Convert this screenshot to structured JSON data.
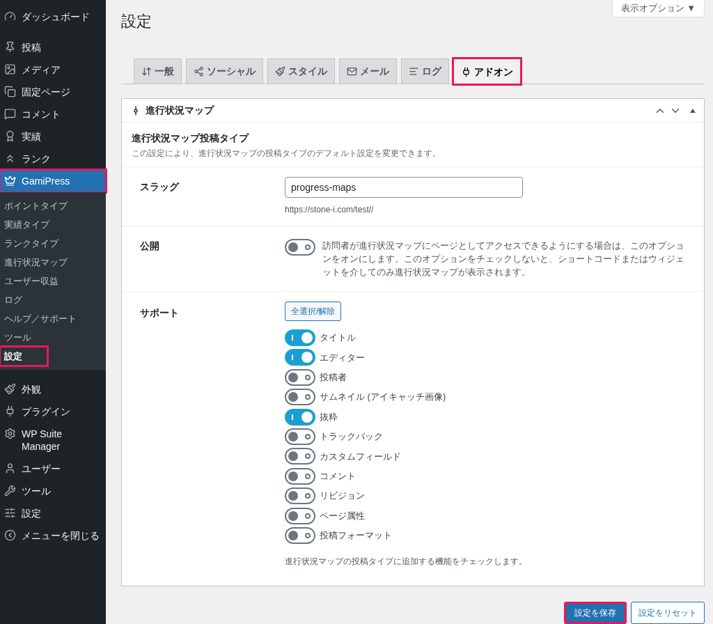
{
  "sidebar": {
    "menu": [
      {
        "label": "ダッシュボード",
        "selected": false,
        "highlighted": false
      },
      {
        "label": "投稿",
        "selected": false,
        "highlighted": false
      },
      {
        "label": "メディア",
        "selected": false,
        "highlighted": false
      },
      {
        "label": "固定ページ",
        "selected": false,
        "highlighted": false
      },
      {
        "label": "コメント",
        "selected": false,
        "highlighted": false
      },
      {
        "label": "実績",
        "selected": false,
        "highlighted": false
      },
      {
        "label": "ランク",
        "selected": false,
        "highlighted": false
      },
      {
        "label": "GamiPress",
        "selected": true,
        "highlighted": true,
        "children": [
          {
            "label": "ポイントタイプ",
            "selected": false,
            "highlighted": false
          },
          {
            "label": "実績タイプ",
            "selected": false,
            "highlighted": false
          },
          {
            "label": "ランクタイプ",
            "selected": false,
            "highlighted": false
          },
          {
            "label": "進行状況マップ",
            "selected": false,
            "highlighted": false
          },
          {
            "label": "ユーザー収益",
            "selected": false,
            "highlighted": false
          },
          {
            "label": "ログ",
            "selected": false,
            "highlighted": false
          },
          {
            "label": "ヘルプ／サポート",
            "selected": false,
            "highlighted": false
          },
          {
            "label": "ツール",
            "selected": false,
            "highlighted": false
          },
          {
            "label": "設定",
            "selected": true,
            "highlighted": true
          }
        ]
      },
      {
        "label": "外観",
        "selected": false,
        "highlighted": false
      },
      {
        "label": "プラグイン",
        "selected": false,
        "highlighted": false
      },
      {
        "label": "WP Suite Manager",
        "selected": false,
        "highlighted": false
      },
      {
        "label": "ユーザー",
        "selected": false,
        "highlighted": false
      },
      {
        "label": "ツール",
        "selected": false,
        "highlighted": false
      },
      {
        "label": "設定",
        "selected": false,
        "highlighted": false
      },
      {
        "label": "メニューを閉じる",
        "selected": false,
        "highlighted": false
      }
    ]
  },
  "page_title": "設定",
  "screen_options": "表示オプション ▼",
  "tabs": [
    {
      "label": "一般",
      "selected": false,
      "highlighted": false
    },
    {
      "label": "ソーシャル",
      "selected": false,
      "highlighted": false
    },
    {
      "label": "スタイル",
      "selected": false,
      "highlighted": false
    },
    {
      "label": "メール",
      "selected": false,
      "highlighted": false
    },
    {
      "label": "ログ",
      "selected": false,
      "highlighted": false
    },
    {
      "label": "アドオン",
      "selected": true,
      "highlighted": true
    }
  ],
  "panel": {
    "title": "進行状況マップ",
    "section_title": "進行状況マップ投稿タイプ",
    "section_description": "この設定により、進行状況マップの投稿タイプのデフォルト設定を変更できます。",
    "slug": {
      "label": "スラッグ",
      "value": "progress-maps",
      "hint": "https://stone-i.com/test//"
    },
    "public": {
      "label": "公開",
      "on": false,
      "description": "訪問者が進行状況マップにページとしてアクセスできるようにする場合は、このオプションをオンにします。このオプションをチェックしないと、ショートコードまたはウィジェットを介してのみ進行状況マップが表示されます。"
    },
    "supports": {
      "label": "サポート",
      "toggle_all": "全選択/解除",
      "items": [
        {
          "label": "タイトル",
          "on": true
        },
        {
          "label": "エディター",
          "on": true
        },
        {
          "label": "投稿者",
          "on": false
        },
        {
          "label": "サムネイル (アイキャッチ画像)",
          "on": false
        },
        {
          "label": "抜粋",
          "on": true
        },
        {
          "label": "トラックバック",
          "on": false
        },
        {
          "label": "カスタムフィールド",
          "on": false
        },
        {
          "label": "コメント",
          "on": false
        },
        {
          "label": "リビジョン",
          "on": false
        },
        {
          "label": "ページ属性",
          "on": false
        },
        {
          "label": "投稿フォーマット",
          "on": false
        }
      ],
      "note": "進行状況マップの投稿タイプに追加する機能をチェックします。"
    }
  },
  "footer": {
    "save": {
      "label": "設定を保存",
      "highlighted": true
    },
    "reset": {
      "label": "設定をリセット"
    }
  }
}
